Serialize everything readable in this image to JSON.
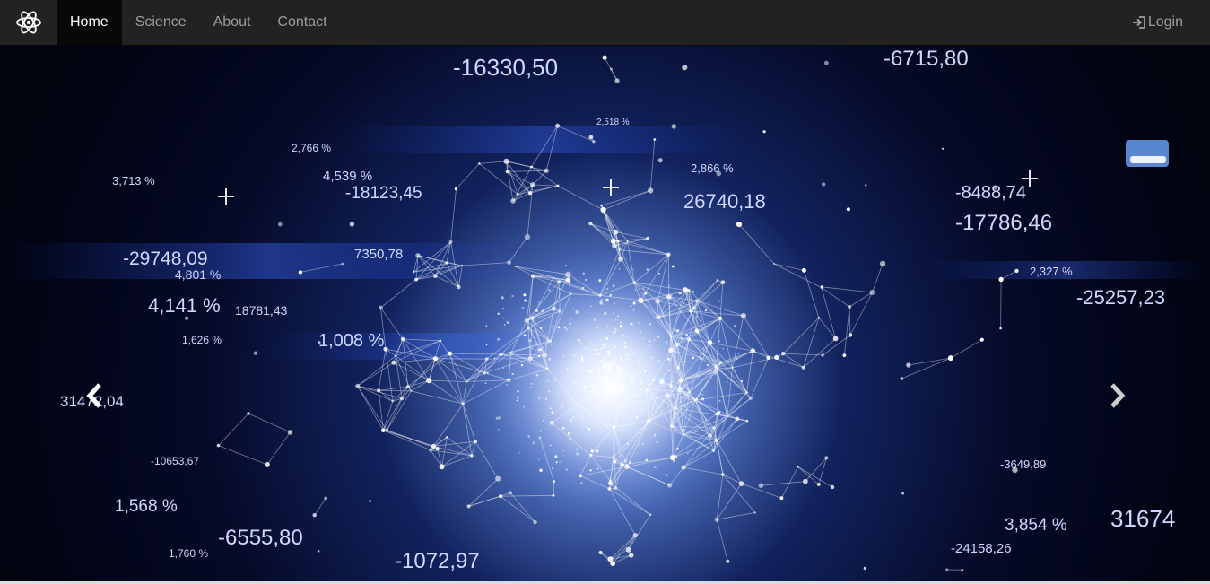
{
  "navbar": {
    "brand_icon": "atom-icon",
    "items": [
      {
        "label": "Home",
        "active": true
      },
      {
        "label": "Science",
        "active": false
      },
      {
        "label": "About",
        "active": false
      },
      {
        "label": "Contact",
        "active": false
      }
    ],
    "login": {
      "label": "Login",
      "icon": "login-icon"
    }
  },
  "carousel": {
    "prev_icon": "chevron-left-icon",
    "next_icon": "chevron-right-icon",
    "figures": [
      "-16330,50",
      "-6715,80",
      "2,766 %",
      "4,539 %",
      "-18123,45",
      "3,713 %",
      "26740,18",
      "-8488,74",
      "-17786,46",
      "-29748,09",
      "4,801 %",
      "4,141 %",
      "18781,43",
      "7350,78",
      "1,626 %",
      "-25257,23",
      "2,327 %",
      "31472,04",
      "-10653,67",
      "1,568 %",
      "-6555,80",
      "1,760 %",
      "-1072,97",
      "-3649,89",
      "3,854 %",
      "31674",
      "-24158,26",
      "2,866 %",
      "2,518 %",
      "1,008 %"
    ]
  },
  "colors": {
    "navbar_bg": "#222222",
    "nav_active_bg": "#080808",
    "nav_text": "#9d9d9d",
    "nav_active_text": "#ffffff"
  }
}
